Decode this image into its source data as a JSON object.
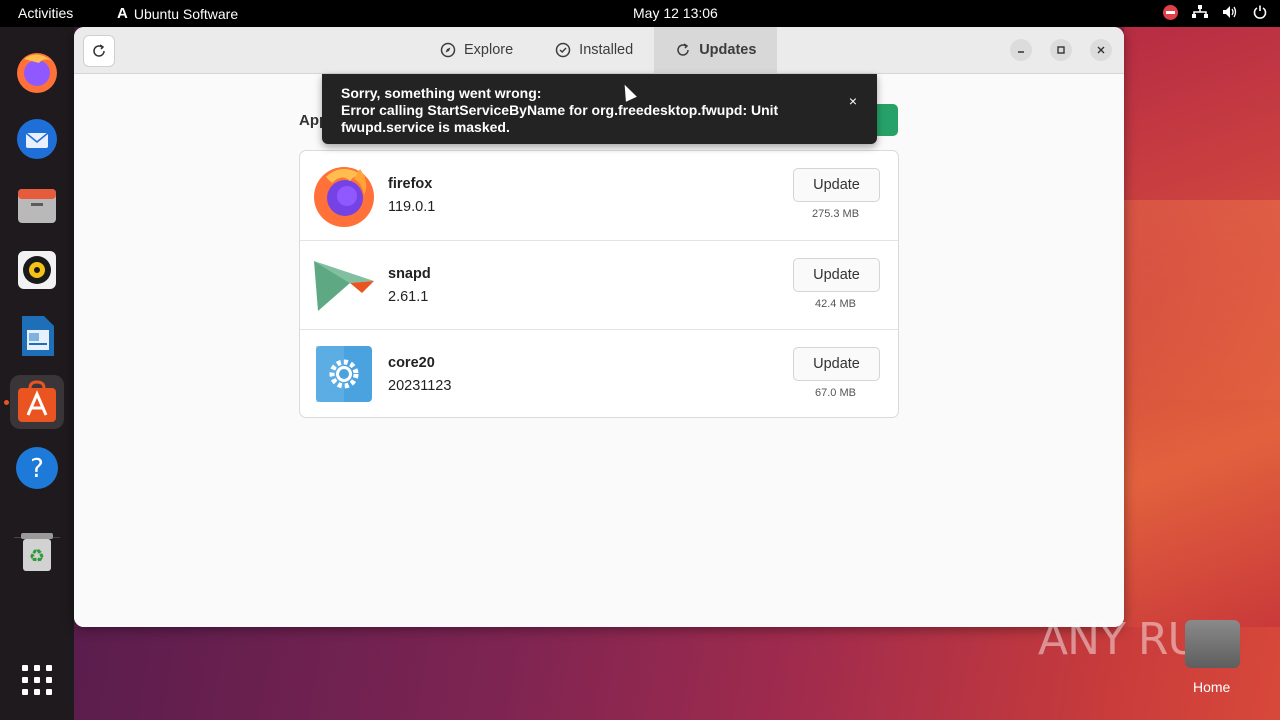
{
  "topbar": {
    "activities": "Activities",
    "app_name": "Ubuntu Software",
    "clock": "May 12  13:06"
  },
  "dock": {
    "items": [
      "firefox",
      "thunderbird",
      "files",
      "rhythmbox",
      "libreoffice-writer",
      "ubuntu-software",
      "help",
      "trash",
      "show-apps"
    ]
  },
  "window": {
    "tabs": [
      {
        "label": "Explore",
        "icon": "compass-icon"
      },
      {
        "label": "Installed",
        "icon": "check-circle-icon"
      },
      {
        "label": "Updates",
        "icon": "refresh-icon",
        "active": true
      }
    ],
    "section_title": "Appl",
    "update_all_label": "l",
    "updates": [
      {
        "name": "firefox",
        "version": "119.0.1",
        "button": "Update",
        "size": "275.3 MB"
      },
      {
        "name": "snapd",
        "version": "2.61.1",
        "button": "Update",
        "size": "42.4 MB"
      },
      {
        "name": "core20",
        "version": "20231123",
        "button": "Update",
        "size": "67.0 MB"
      }
    ]
  },
  "toast": {
    "line1": "Sorry, something went wrong:",
    "line2": "Error calling StartServiceByName for org.freedesktop.fwupd: Unit",
    "line3": "fwupd.service is masked.",
    "close": "×"
  },
  "desktop": {
    "watermark": "ANY RUN",
    "home_label": "Home"
  },
  "colors": {
    "accent_orange": "#e95420",
    "update_green": "#26a269",
    "toast_bg": "#232323"
  }
}
